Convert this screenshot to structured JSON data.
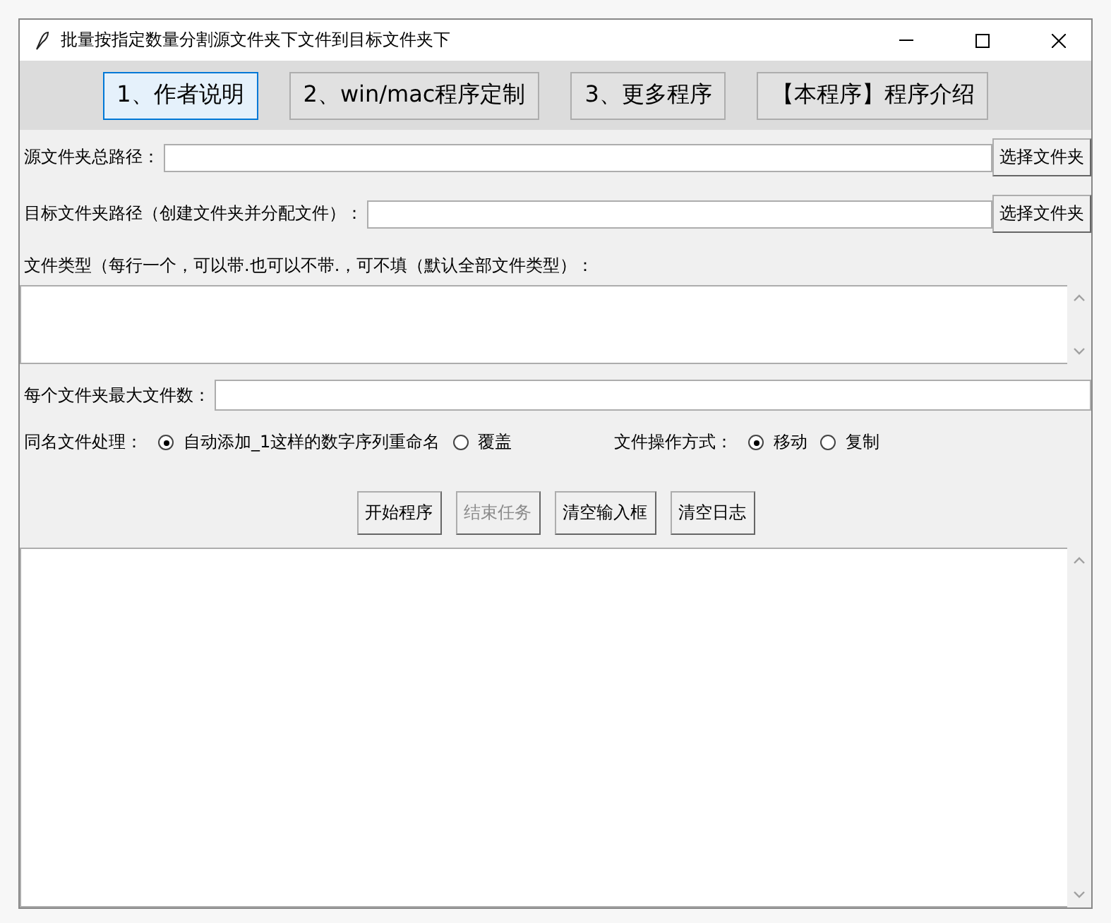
{
  "window": {
    "title": "批量按指定数量分割源文件夹下文件到目标文件夹下"
  },
  "top_buttons": [
    {
      "label": "1、作者说明",
      "selected": true
    },
    {
      "label": "2、win/mac程序定制",
      "selected": false
    },
    {
      "label": "3、更多程序",
      "selected": false
    },
    {
      "label": "【本程序】程序介绍",
      "selected": false
    }
  ],
  "path_fields": [
    {
      "label": "源文件夹总路径：",
      "button": "选择文件夹"
    },
    {
      "label": "目标文件夹路径（创建文件夹并分配文件）：",
      "button": "选择文件夹"
    }
  ],
  "file_types": {
    "label": "文件类型（每行一个，可以带.也可以不带.，可不填（默认全部文件类型）："
  },
  "max_files": {
    "label": "每个文件夹最大文件数："
  },
  "radio_groups": [
    {
      "label": "同名文件处理：",
      "options": [
        {
          "label": "自动添加_1这样的数字序列重命名",
          "selected": true
        },
        {
          "label": "覆盖",
          "selected": false
        }
      ]
    },
    {
      "label": "文件操作方式：",
      "options": [
        {
          "label": "移动",
          "selected": true
        },
        {
          "label": "复制",
          "selected": false
        }
      ]
    }
  ],
  "actions": [
    {
      "label": "开始程序",
      "disabled": false
    },
    {
      "label": "结束任务",
      "disabled": true
    },
    {
      "label": "清空输入框",
      "disabled": false
    },
    {
      "label": "清空日志",
      "disabled": false
    }
  ]
}
